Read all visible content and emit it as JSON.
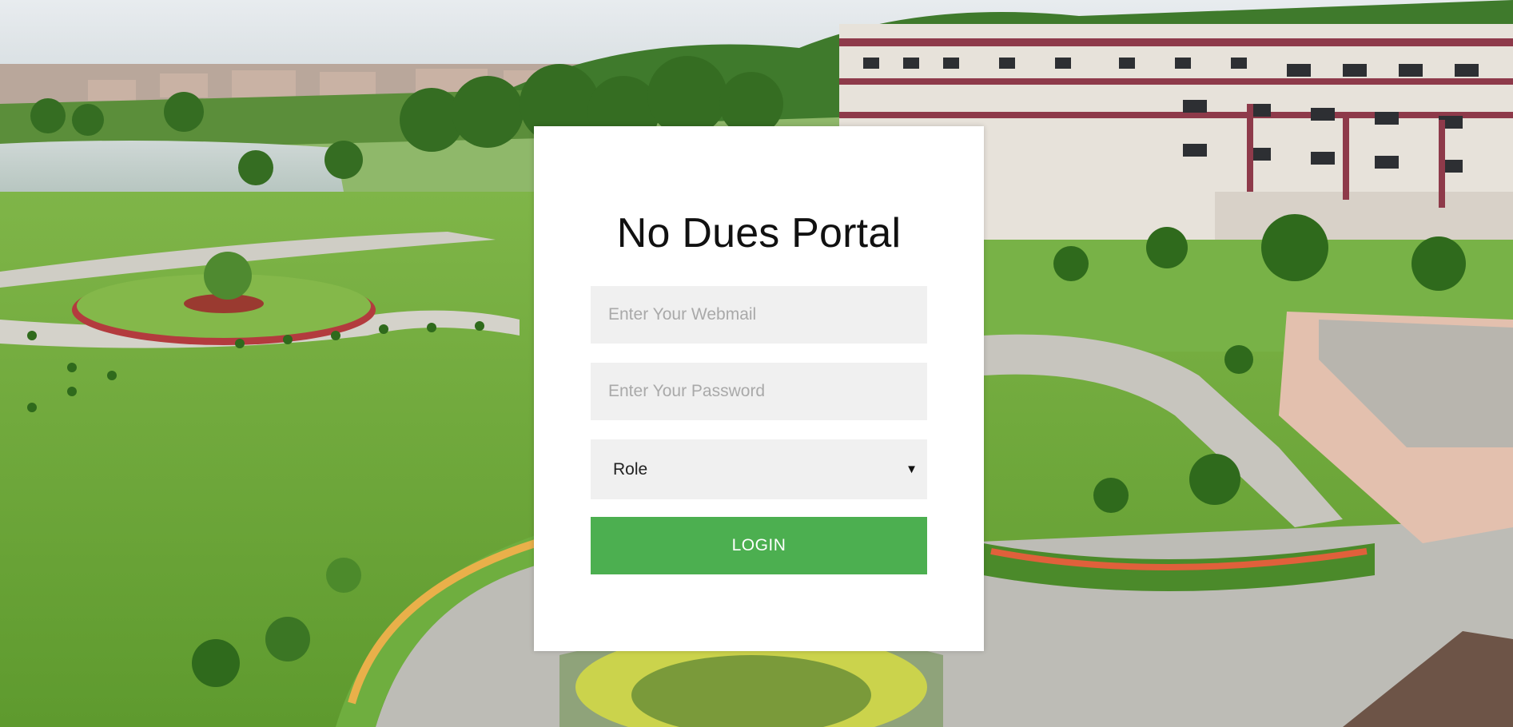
{
  "login": {
    "title": "No Dues Portal",
    "webmail_placeholder": "Enter Your Webmail",
    "password_placeholder": "Enter Your Password",
    "role_selected": "Role",
    "login_label": "LOGIN"
  },
  "colors": {
    "accent": "#4caf50",
    "field_bg": "#f0f0f0",
    "card_bg": "#ffffff"
  }
}
